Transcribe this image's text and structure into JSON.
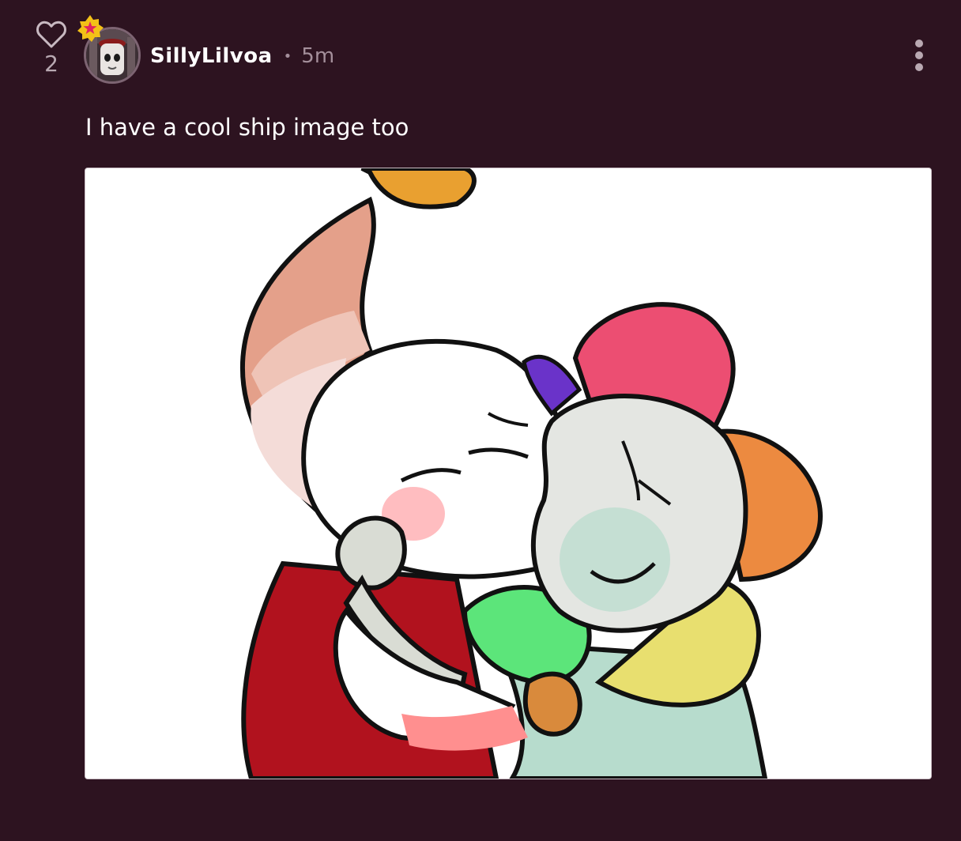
{
  "post": {
    "like_count": "2",
    "username": "SillyLilvoa",
    "separator": "•",
    "timestamp": "5m",
    "body_text": "I have a cool ship image too"
  },
  "icons": {
    "like": "heart-icon",
    "badge": "star-badge-icon",
    "menu": "more-vertical-icon"
  },
  "colors": {
    "background": "#2d1320",
    "muted_text": "#a48f9b",
    "badge_fill": "#f3c117",
    "badge_star": "#e0245e"
  }
}
